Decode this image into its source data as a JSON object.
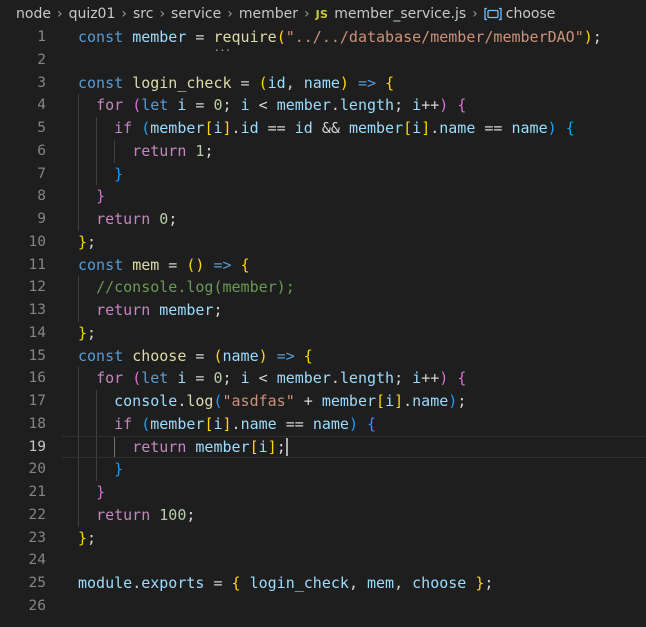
{
  "breadcrumb": {
    "items": [
      "node",
      "quiz01",
      "src",
      "service",
      "member"
    ],
    "file_badge": "JS",
    "file_name": "member_service.js",
    "symbol_icon": "symbol-variable-icon",
    "symbol": "choose"
  },
  "editor": {
    "current_line": 19,
    "lines": [
      {
        "n": "1",
        "tokens": [
          [
            "const ",
            "t-kw"
          ],
          [
            "member",
            "t-var"
          ],
          [
            " = ",
            "t-op"
          ],
          [
            "require",
            "t-fn hint-dots"
          ],
          [
            "(",
            "t-br1"
          ],
          [
            "\"../../database/member/memberDAO\"",
            "t-str"
          ],
          [
            ")",
            "t-br1"
          ],
          [
            ";",
            "t-pn"
          ]
        ]
      },
      {
        "n": "2",
        "tokens": []
      },
      {
        "n": "3",
        "tokens": [
          [
            "const ",
            "t-kw"
          ],
          [
            "login_check",
            "t-fn"
          ],
          [
            " = ",
            "t-op"
          ],
          [
            "(",
            "t-br1"
          ],
          [
            "id",
            "t-var"
          ],
          [
            ", ",
            "t-pn"
          ],
          [
            "name",
            "t-var"
          ],
          [
            ")",
            "t-br1"
          ],
          [
            " ",
            "t-op"
          ],
          [
            "=>",
            "t-kw"
          ],
          [
            " ",
            "t-op"
          ],
          [
            "{",
            "t-br1"
          ]
        ]
      },
      {
        "n": "4",
        "tokens": [
          [
            "  ",
            "t-op"
          ],
          [
            "for",
            "t-ctl"
          ],
          [
            " ",
            "t-op"
          ],
          [
            "(",
            "t-br2"
          ],
          [
            "let ",
            "t-kw"
          ],
          [
            "i",
            "t-var"
          ],
          [
            " = ",
            "t-op"
          ],
          [
            "0",
            "t-num"
          ],
          [
            "; ",
            "t-pn"
          ],
          [
            "i",
            "t-var"
          ],
          [
            " < ",
            "t-op"
          ],
          [
            "member",
            "t-var"
          ],
          [
            ".",
            "t-pn"
          ],
          [
            "length",
            "t-var"
          ],
          [
            "; ",
            "t-pn"
          ],
          [
            "i",
            "t-var"
          ],
          [
            "++",
            "t-op"
          ],
          [
            ")",
            "t-br2"
          ],
          [
            " ",
            "t-op"
          ],
          [
            "{",
            "t-br2"
          ]
        ]
      },
      {
        "n": "5",
        "tokens": [
          [
            "    ",
            "t-op"
          ],
          [
            "if",
            "t-ctl"
          ],
          [
            " ",
            "t-op"
          ],
          [
            "(",
            "t-br3"
          ],
          [
            "member",
            "t-var"
          ],
          [
            "[",
            "t-br1"
          ],
          [
            "i",
            "t-var"
          ],
          [
            "]",
            "t-br1"
          ],
          [
            ".",
            "t-pn"
          ],
          [
            "id",
            "t-var"
          ],
          [
            " == ",
            "t-op"
          ],
          [
            "id",
            "t-var"
          ],
          [
            " && ",
            "t-op"
          ],
          [
            "member",
            "t-var"
          ],
          [
            "[",
            "t-br1"
          ],
          [
            "i",
            "t-var"
          ],
          [
            "]",
            "t-br1"
          ],
          [
            ".",
            "t-pn"
          ],
          [
            "name",
            "t-var"
          ],
          [
            " == ",
            "t-op"
          ],
          [
            "name",
            "t-var"
          ],
          [
            ")",
            "t-br3"
          ],
          [
            " ",
            "t-op"
          ],
          [
            "{",
            "t-br3"
          ]
        ]
      },
      {
        "n": "6",
        "tokens": [
          [
            "      ",
            "t-op"
          ],
          [
            "return",
            "t-ctl"
          ],
          [
            " ",
            "t-op"
          ],
          [
            "1",
            "t-num"
          ],
          [
            ";",
            "t-pn"
          ]
        ]
      },
      {
        "n": "7",
        "tokens": [
          [
            "    ",
            "t-op"
          ],
          [
            "}",
            "t-br3"
          ]
        ]
      },
      {
        "n": "8",
        "tokens": [
          [
            "  ",
            "t-op"
          ],
          [
            "}",
            "t-br2"
          ]
        ]
      },
      {
        "n": "9",
        "tokens": [
          [
            "  ",
            "t-op"
          ],
          [
            "return",
            "t-ctl"
          ],
          [
            " ",
            "t-op"
          ],
          [
            "0",
            "t-num"
          ],
          [
            ";",
            "t-pn"
          ]
        ]
      },
      {
        "n": "10",
        "tokens": [
          [
            "}",
            "t-br1"
          ],
          [
            ";",
            "t-pn"
          ]
        ]
      },
      {
        "n": "11",
        "tokens": [
          [
            "const ",
            "t-kw"
          ],
          [
            "mem",
            "t-fn"
          ],
          [
            " = ",
            "t-op"
          ],
          [
            "(",
            "t-br1"
          ],
          [
            ")",
            "t-br1"
          ],
          [
            " ",
            "t-op"
          ],
          [
            "=>",
            "t-kw"
          ],
          [
            " ",
            "t-op"
          ],
          [
            "{",
            "t-br1"
          ]
        ]
      },
      {
        "n": "12",
        "tokens": [
          [
            "  ",
            "t-op"
          ],
          [
            "//console.log(member);",
            "t-cm"
          ]
        ]
      },
      {
        "n": "13",
        "tokens": [
          [
            "  ",
            "t-op"
          ],
          [
            "return",
            "t-ctl"
          ],
          [
            " ",
            "t-op"
          ],
          [
            "member",
            "t-var"
          ],
          [
            ";",
            "t-pn"
          ]
        ]
      },
      {
        "n": "14",
        "tokens": [
          [
            "}",
            "t-br1"
          ],
          [
            ";",
            "t-pn"
          ]
        ]
      },
      {
        "n": "15",
        "tokens": [
          [
            "const ",
            "t-kw"
          ],
          [
            "choose",
            "t-fn"
          ],
          [
            " = ",
            "t-op"
          ],
          [
            "(",
            "t-br1"
          ],
          [
            "name",
            "t-var"
          ],
          [
            ")",
            "t-br1"
          ],
          [
            " ",
            "t-op"
          ],
          [
            "=>",
            "t-kw"
          ],
          [
            " ",
            "t-op"
          ],
          [
            "{",
            "t-br1"
          ]
        ]
      },
      {
        "n": "16",
        "tokens": [
          [
            "  ",
            "t-op"
          ],
          [
            "for",
            "t-ctl"
          ],
          [
            " ",
            "t-op"
          ],
          [
            "(",
            "t-br2"
          ],
          [
            "let ",
            "t-kw"
          ],
          [
            "i",
            "t-var"
          ],
          [
            " = ",
            "t-op"
          ],
          [
            "0",
            "t-num"
          ],
          [
            "; ",
            "t-pn"
          ],
          [
            "i",
            "t-var"
          ],
          [
            " < ",
            "t-op"
          ],
          [
            "member",
            "t-var"
          ],
          [
            ".",
            "t-pn"
          ],
          [
            "length",
            "t-var"
          ],
          [
            "; ",
            "t-pn"
          ],
          [
            "i",
            "t-var"
          ],
          [
            "++",
            "t-op"
          ],
          [
            ")",
            "t-br2"
          ],
          [
            " ",
            "t-op"
          ],
          [
            "{",
            "t-br2"
          ]
        ]
      },
      {
        "n": "17",
        "tokens": [
          [
            "    ",
            "t-op"
          ],
          [
            "console",
            "t-var"
          ],
          [
            ".",
            "t-pn"
          ],
          [
            "log",
            "t-fn"
          ],
          [
            "(",
            "t-br3"
          ],
          [
            "\"asdfas\"",
            "t-str"
          ],
          [
            " + ",
            "t-op"
          ],
          [
            "member",
            "t-var"
          ],
          [
            "[",
            "t-br1"
          ],
          [
            "i",
            "t-var"
          ],
          [
            "]",
            "t-br1"
          ],
          [
            ".",
            "t-pn"
          ],
          [
            "name",
            "t-var"
          ],
          [
            ")",
            "t-br3"
          ],
          [
            ";",
            "t-pn"
          ]
        ]
      },
      {
        "n": "18",
        "tokens": [
          [
            "    ",
            "t-op"
          ],
          [
            "if",
            "t-ctl"
          ],
          [
            " ",
            "t-op"
          ],
          [
            "(",
            "t-br3"
          ],
          [
            "member",
            "t-var"
          ],
          [
            "[",
            "t-br1"
          ],
          [
            "i",
            "t-var"
          ],
          [
            "]",
            "t-br1"
          ],
          [
            ".",
            "t-pn"
          ],
          [
            "name",
            "t-var"
          ],
          [
            " == ",
            "t-op"
          ],
          [
            "name",
            "t-var"
          ],
          [
            ")",
            "t-br3"
          ],
          [
            " ",
            "t-op"
          ],
          [
            "{",
            "t-br3"
          ]
        ]
      },
      {
        "n": "19",
        "tokens": [
          [
            "      ",
            "t-op"
          ],
          [
            "return",
            "t-ctl"
          ],
          [
            " ",
            "t-op"
          ],
          [
            "member",
            "t-var"
          ],
          [
            "[",
            "t-br1"
          ],
          [
            "i",
            "t-var"
          ],
          [
            "]",
            "t-br1"
          ],
          [
            ";",
            "t-pn"
          ]
        ]
      },
      {
        "n": "20",
        "tokens": [
          [
            "    ",
            "t-op"
          ],
          [
            "}",
            "t-br3"
          ]
        ]
      },
      {
        "n": "21",
        "tokens": [
          [
            "  ",
            "t-op"
          ],
          [
            "}",
            "t-br2"
          ]
        ]
      },
      {
        "n": "22",
        "tokens": [
          [
            "  ",
            "t-op"
          ],
          [
            "return",
            "t-ctl"
          ],
          [
            " ",
            "t-op"
          ],
          [
            "100",
            "t-num"
          ],
          [
            ";",
            "t-pn"
          ]
        ]
      },
      {
        "n": "23",
        "tokens": [
          [
            "}",
            "t-br1"
          ],
          [
            ";",
            "t-pn"
          ]
        ]
      },
      {
        "n": "24",
        "tokens": []
      },
      {
        "n": "25",
        "tokens": [
          [
            "module",
            "t-var"
          ],
          [
            ".",
            "t-pn"
          ],
          [
            "exports",
            "t-var"
          ],
          [
            " = ",
            "t-op"
          ],
          [
            "{",
            "t-br1"
          ],
          [
            " ",
            "t-op"
          ],
          [
            "login_check",
            "t-var"
          ],
          [
            ", ",
            "t-pn"
          ],
          [
            "mem",
            "t-var"
          ],
          [
            ", ",
            "t-pn"
          ],
          [
            "choose",
            "t-var"
          ],
          [
            " ",
            "t-op"
          ],
          [
            "}",
            "t-br1"
          ],
          [
            ";",
            "t-pn"
          ]
        ]
      },
      {
        "n": "26",
        "tokens": []
      }
    ]
  }
}
